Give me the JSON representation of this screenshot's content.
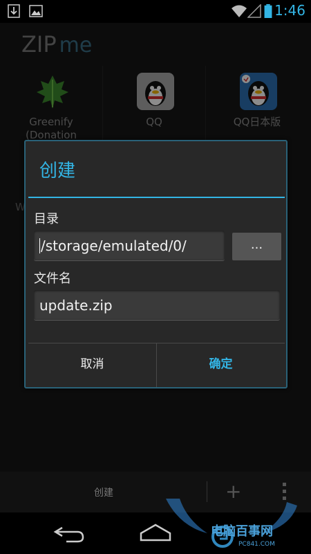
{
  "status_bar": {
    "time": "1:46",
    "icons": [
      "download-icon",
      "image-icon",
      "wifi-icon",
      "signal-icon",
      "battery-icon"
    ]
  },
  "app": {
    "logo_main": "ZIP",
    "logo_sub": "me",
    "apps": [
      {
        "label": "Greenify\n(Donation",
        "icon": "greenify-leaf-icon"
      },
      {
        "label": "QQ",
        "icon": "qq-penguin-icon"
      },
      {
        "label": "QQ日本版",
        "icon": "qq-japan-penguin-icon"
      }
    ],
    "partial_left_label": "W"
  },
  "dialog": {
    "title": "创建",
    "directory_label": "目录",
    "directory_value": "/storage/emulated/0/",
    "browse_label": "...",
    "filename_label": "文件名",
    "filename_value": "update.zip",
    "cancel_label": "取消",
    "ok_label": "确定"
  },
  "bottom_bar": {
    "create_label": "创建",
    "add_icon": "plus-icon",
    "more_icon": "overflow-menu-icon"
  },
  "nav_bar": {
    "buttons": [
      "back-icon",
      "home-icon"
    ]
  },
  "watermark": {
    "text": "电脑百事网",
    "sub": "PC841.COM"
  },
  "colors": {
    "accent": "#33b5e5",
    "dialog_bg": "#282828",
    "app_bg": "#171717"
  }
}
